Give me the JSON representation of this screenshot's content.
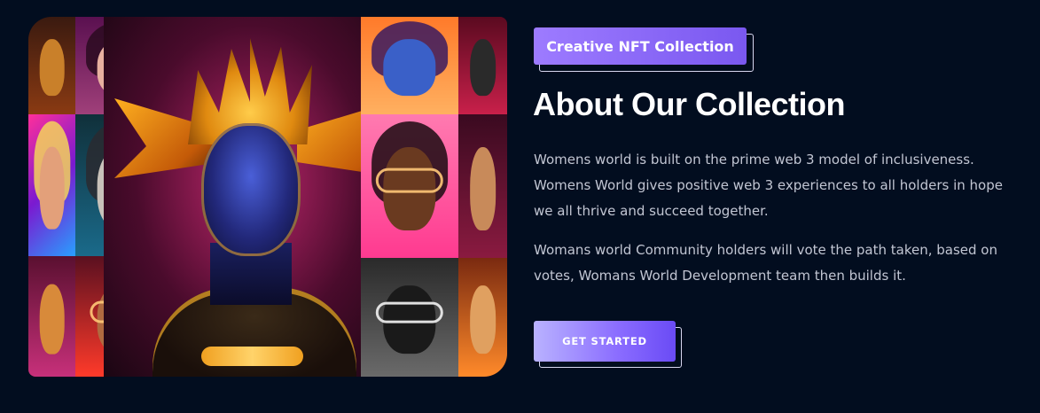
{
  "collection": {
    "tag_label": "Creative NFT Collection",
    "title": "About Our Collection",
    "paragraph_1": "Womens world is built on the prime web 3 model of inclusiveness. Womens World gives positive web 3 experiences to all holders in hope we all thrive and succeed together.",
    "paragraph_2": "Womans world Community holders will vote the path taken, based on votes, Womans World Development team then builds it.",
    "cta_label": "GET STARTED"
  },
  "colors": {
    "background": "#020d1f",
    "accent_start": "#9d7bff",
    "accent_end": "#6a4bf5",
    "heading": "#ffffff",
    "body_text": "#c2c6d3"
  }
}
